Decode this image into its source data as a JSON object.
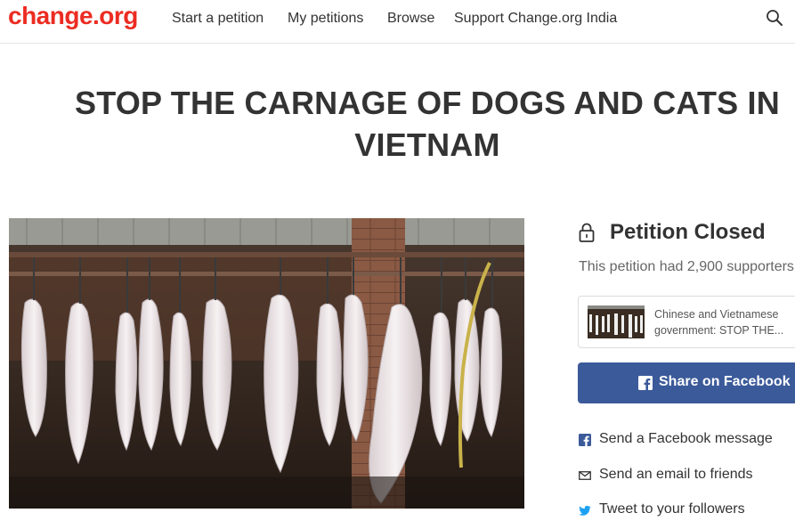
{
  "header": {
    "logo": "change.org",
    "nav": {
      "start": "Start a petition",
      "mine": "My petitions",
      "browse": "Browse",
      "support": "Support Change.org India"
    },
    "search_icon": "search-icon"
  },
  "petition": {
    "title": "STOP THE CARNAGE OF DOGS AND CATS IN VIETNAM"
  },
  "sidebar": {
    "status_icon": "lock-icon",
    "status": "Petition Closed",
    "supporters": "This petition had 2,900 supporters",
    "card": {
      "line1": "Chinese and Vietnamese",
      "line2": "government: STOP THE..."
    },
    "share": {
      "facebook_button": "Share on Facebook",
      "facebook_message": "Send a Facebook message",
      "email": "Send an email to friends",
      "tweet": "Tweet to your followers"
    }
  },
  "colors": {
    "brand": "#ec2c22",
    "facebook": "#3b5a9a",
    "twitter": "#1da1f2"
  }
}
